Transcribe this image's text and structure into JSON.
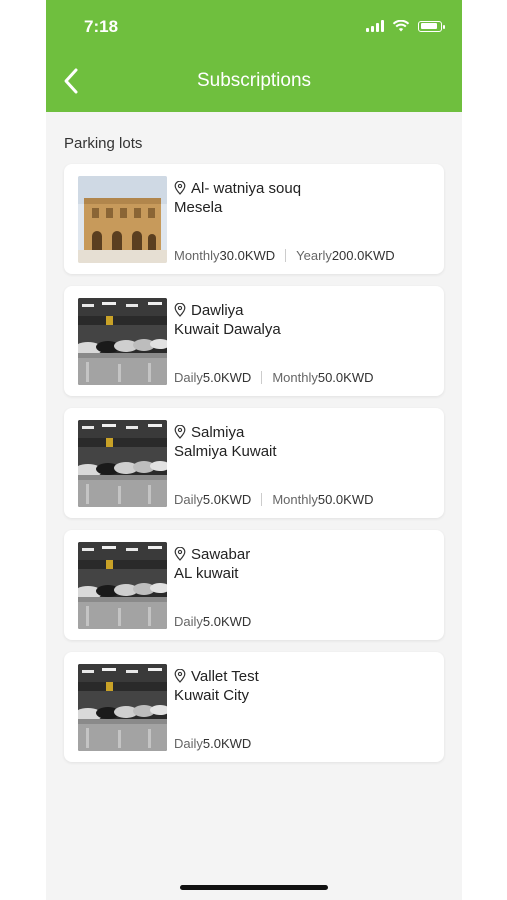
{
  "status_bar": {
    "time": "7:18"
  },
  "header": {
    "title": "Subscriptions"
  },
  "section": {
    "label": "Parking lots"
  },
  "lots": [
    {
      "name": "Al- watniya souq",
      "area": "Mesela",
      "image": "building",
      "prices": [
        {
          "label": "Monthly",
          "value": "30.0KWD"
        },
        {
          "label": "Yearly",
          "value": "200.0KWD"
        }
      ]
    },
    {
      "name": "Dawliya",
      "area": "Kuwait Dawalya",
      "image": "garage",
      "prices": [
        {
          "label": "Daily",
          "value": "5.0KWD"
        },
        {
          "label": "Monthly",
          "value": "50.0KWD"
        }
      ]
    },
    {
      "name": "Salmiya",
      "area": "Salmiya Kuwait",
      "image": "garage",
      "prices": [
        {
          "label": "Daily",
          "value": "5.0KWD"
        },
        {
          "label": "Monthly",
          "value": "50.0KWD"
        }
      ]
    },
    {
      "name": "Sawabar",
      "area": "AL kuwait",
      "image": "garage",
      "prices": [
        {
          "label": "Daily",
          "value": "5.0KWD"
        }
      ]
    },
    {
      "name": "Vallet Test",
      "area": "Kuwait City",
      "image": "garage",
      "prices": [
        {
          "label": "Daily",
          "value": "5.0KWD"
        }
      ]
    }
  ],
  "colors": {
    "header": "#6fbf3e",
    "background": "#f4f4f4"
  }
}
